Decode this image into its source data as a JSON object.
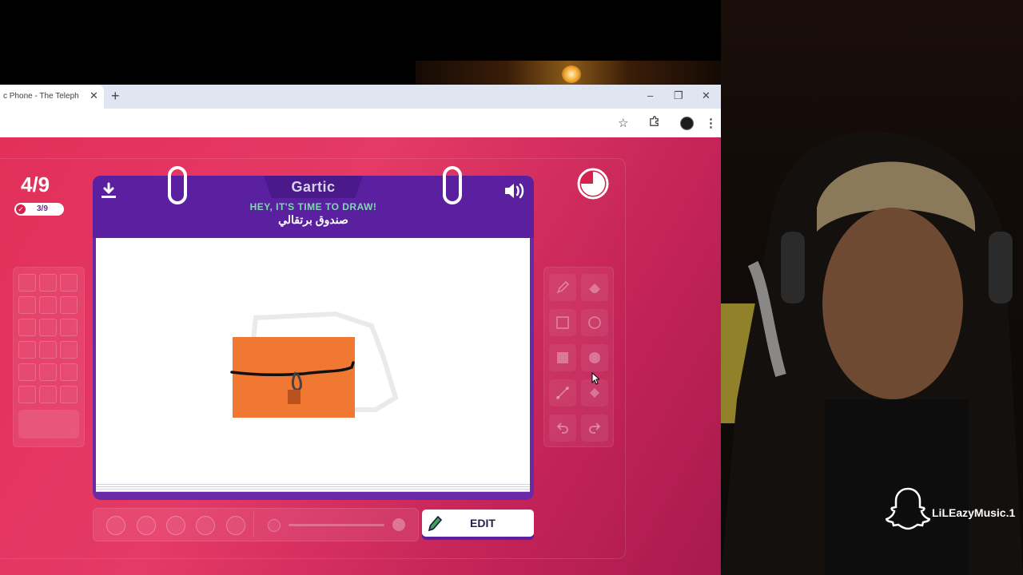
{
  "browser": {
    "tab_title": "c Phone - The Telephone G",
    "tab_close": "✕",
    "new_tab": "+",
    "controls": [
      "–",
      "❐",
      "✕"
    ]
  },
  "game": {
    "round": "4/9",
    "players_done": "3/9",
    "logo": "Gartic",
    "title": "HEY, IT'S TIME TO DRAW!",
    "prompt": "صندوق برتقالي",
    "edit_label": "EDIT",
    "colors": {
      "background": "#e2305a",
      "notebook": "#5a20a0",
      "title_accent": "#7dd9b0",
      "drawing_fill": "#f07832",
      "drawing_lock": "#b8521e"
    },
    "tools": [
      "pencil-icon",
      "eraser-icon",
      "rectangle-outline-icon",
      "circle-outline-icon",
      "rectangle-filled-icon",
      "circle-filled-icon",
      "line-icon",
      "fill-bucket-icon",
      "undo-icon",
      "redo-icon"
    ]
  },
  "streamer": {
    "handle": "LiLEazyMusic.1"
  }
}
